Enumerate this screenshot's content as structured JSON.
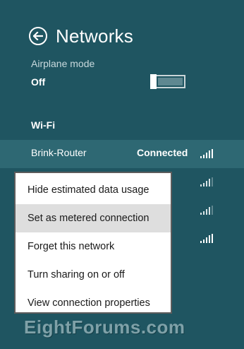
{
  "header": {
    "title": "Networks"
  },
  "airplane": {
    "label": "Airplane mode",
    "state": "Off",
    "enabled": false
  },
  "wifi": {
    "section_label": "Wi-Fi",
    "networks": [
      {
        "name": "Brink-Router",
        "status": "Connected",
        "signal_bars": 5
      },
      {
        "name": "",
        "status": "",
        "signal_bars": 4
      },
      {
        "name": "",
        "status": "",
        "signal_bars": 4
      },
      {
        "name": "",
        "status": "",
        "signal_bars": 5
      }
    ]
  },
  "context_menu": {
    "items": [
      {
        "label": "Hide estimated data usage"
      },
      {
        "label": "Set as metered connection",
        "hovered": true
      },
      {
        "label": "Forget this network"
      },
      {
        "label": "Turn sharing on or off"
      },
      {
        "label": "View connection properties"
      }
    ]
  },
  "watermark": {
    "text": "EightForums.com"
  },
  "colors": {
    "background": "#1f5561",
    "selected_row": "#2e6873",
    "menu_bg": "#ffffff",
    "menu_hover": "#dedede"
  }
}
